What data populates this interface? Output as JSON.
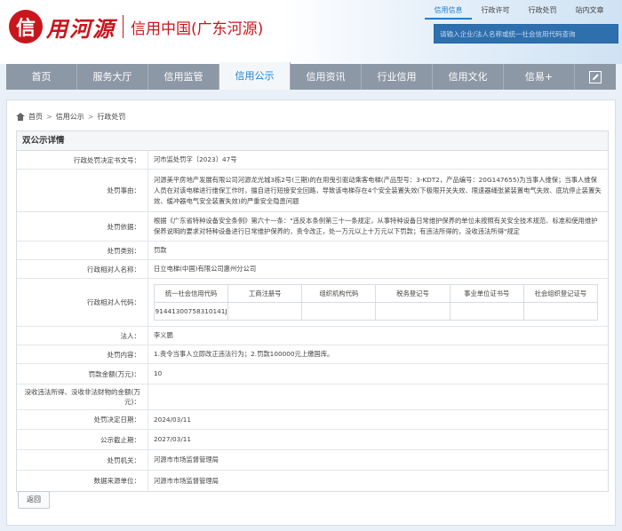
{
  "brand": {
    "logo_char": "信",
    "logo_text": "用河源",
    "subtitle": "信用中国(广东河源)"
  },
  "top_tabs": [
    {
      "label": "信用信息",
      "active": true
    },
    {
      "label": "行政许可",
      "active": false
    },
    {
      "label": "行政处罚",
      "active": false
    },
    {
      "label": "站内文章",
      "active": false
    }
  ],
  "search": {
    "placeholder": "请输入企业/法人名称或统一社会信用代码查询"
  },
  "nav": [
    {
      "label": "首页",
      "active": false
    },
    {
      "label": "服务大厅",
      "active": false
    },
    {
      "label": "信用监管",
      "active": false
    },
    {
      "label": "信用公示",
      "active": true
    },
    {
      "label": "信用资讯",
      "active": false
    },
    {
      "label": "行业信用",
      "active": false
    },
    {
      "label": "信用文化",
      "active": false
    },
    {
      "label": "信易+",
      "active": false
    }
  ],
  "breadcrumb": {
    "home": "首页",
    "level1": "信用公示",
    "level2": "行政处罚",
    "sep": ">"
  },
  "section_title": "双公示详情",
  "details": {
    "doc_no": {
      "label": "行政处罚决定书文号：",
      "value": "河市监处罚字〔2023〕47号"
    },
    "reason": {
      "label": "处罚事由：",
      "value": "河源美平房地产发展有限公司河源龙光城3栋2号(三期)的在用曳引驱动乘客电梯(产品型号：3-KDT2，产品编号：20G147655)为当事人维保；当事人维保人员在对该电梯进行维保工作时，擅自进行短接安全回路，导致该电梯存在4个安全装置失效(下极限开关失效、限速器绳张紧装置电气失效、底坑停止装置失效、缓冲器电气安全装置失效)的严重安全隐患问题"
    },
    "basis": {
      "label": "处罚依据：",
      "value": "根据《广东省特种设备安全条例》第六十一条：\"违反本条例第三十一条规定，从事特种设备日常维护保养的单位未按照有关安全技术规范、标准和使用维护保养说明的要求对特种设备进行日常维护保养的，责令改正，处一万元以上十万元以下罚款；有违法所得的，没收违法所得\"规定"
    },
    "category": {
      "label": "处罚类别：",
      "value": "罚款"
    },
    "party_name": {
      "label": "行政相对人名称：",
      "value": "日立电梯(中国)有限公司惠州分公司"
    },
    "party_code": {
      "label": "行政相对人代码：",
      "headers": [
        "统一社会信用代码",
        "工商注册号",
        "组织机构代码",
        "税务登记号",
        "事业单位证书号",
        "社会组织登记证号"
      ],
      "values": [
        "91441300758310141J",
        "",
        "",
        "",
        "",
        ""
      ]
    },
    "legal_rep": {
      "label": "法人：",
      "value": "李义鹏"
    },
    "content": {
      "label": "处罚内容：",
      "value": "1.责令当事人立即改正违法行为；2.罚款100000元上缴国库。"
    },
    "fine": {
      "label": "罚款金额(万元)：",
      "value": "10"
    },
    "confiscation": {
      "label": "没收违法所得、没收非法财物的金额(万元)：",
      "value": ""
    },
    "decision_date": {
      "label": "处罚决定日期：",
      "value": "2024/03/11"
    },
    "expiry_date": {
      "label": "公示截止期：",
      "value": "2027/03/11"
    },
    "authority": {
      "label": "处罚机关：",
      "value": "河源市市场监督管理局"
    },
    "source": {
      "label": "数据来源单位：",
      "value": "河源市市场监督管理局"
    }
  },
  "back_label": "返回",
  "colors": {
    "brand_red": "#c8161d",
    "accent_blue": "#1f7fd0",
    "nav_gray": "#8d98a6"
  }
}
